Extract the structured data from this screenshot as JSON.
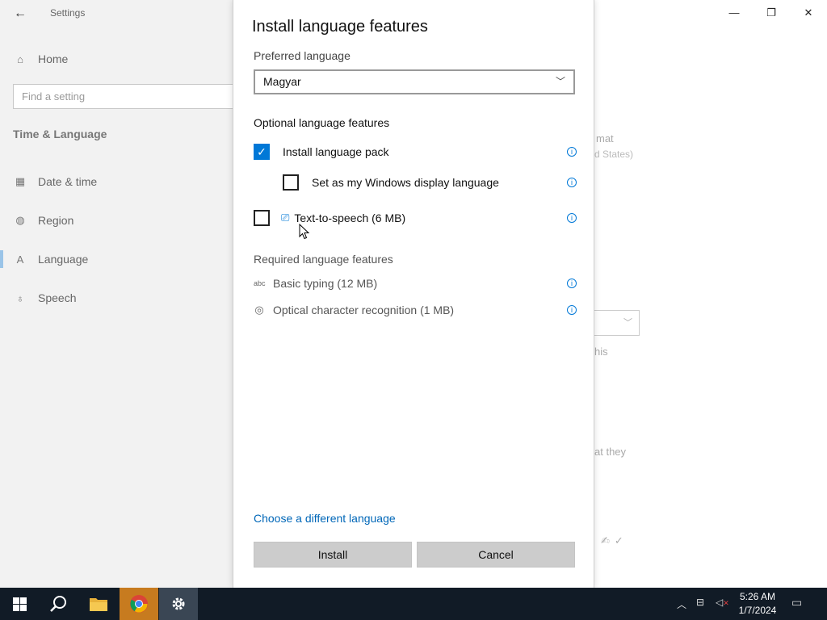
{
  "window": {
    "app_title": "Settings",
    "back_icon": "←",
    "caption": {
      "minimize": "—",
      "restore": "❐",
      "close": "✕"
    }
  },
  "sidebar": {
    "home_label": "Home",
    "search_placeholder": "Find a setting",
    "section_title": "Time & Language",
    "items": [
      {
        "label": "Date & time",
        "icon": "calendar-clock-icon"
      },
      {
        "label": "Region",
        "icon": "globe-icon"
      },
      {
        "label": "Language",
        "icon": "language-icon"
      },
      {
        "label": "Speech",
        "icon": "microphone-icon"
      }
    ]
  },
  "background_fragments": {
    "frag1": "mat",
    "frag2": "d States)",
    "frag3": "his",
    "frag4": "at they"
  },
  "dialog": {
    "title": "Install language features",
    "preferred_label": "Preferred language",
    "selected_language": "Magyar",
    "optional_label": "Optional language features",
    "option_pack": "Install language pack",
    "option_display": "Set as my Windows display language",
    "option_tts": "Text-to-speech (6 MB)",
    "required_label": "Required language features",
    "req_typing": "Basic typing (12 MB)",
    "req_ocr": "Optical character recognition (1 MB)",
    "choose_link": "Choose a different language",
    "install_button": "Install",
    "cancel_button": "Cancel",
    "states": {
      "pack_checked": true,
      "display_checked": false,
      "tts_checked": false
    }
  },
  "taskbar": {
    "time": "5:26 AM",
    "date": "1/7/2024",
    "accent_chrome": "#c77b1f",
    "active_app": "settings"
  },
  "colors": {
    "accent": "#0078d7",
    "link": "#0067b8",
    "taskbar": "#111b26"
  }
}
